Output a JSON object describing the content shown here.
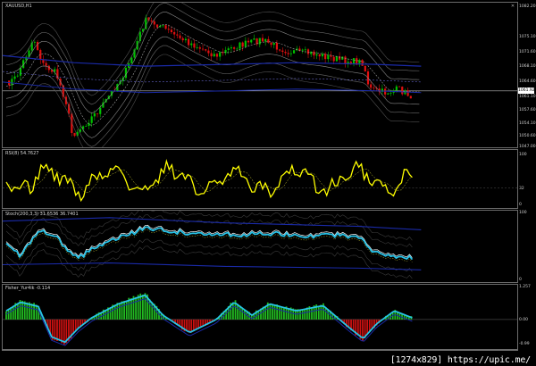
{
  "window": {
    "main_label": "XAUUSD,H1",
    "rsi_label": "RSI(8) 54.7627",
    "stoch_label": "Stoch(200,3,3) 31.6536 36.7401",
    "fisher_label": "Fisher_Yur4ik -0.114"
  },
  "main_axis": [
    "1082.20",
    "1075.10",
    "1071.60",
    "1068.10",
    "1064.60",
    "1061.10",
    "1057.60",
    "1054.10",
    "1050.60",
    "1047.00"
  ],
  "current_price": "1061.92",
  "rsi_axis": [
    "100",
    "32",
    "0"
  ],
  "stoch_axis": [
    "100",
    "0"
  ],
  "fisher_axis": [
    "1.257",
    "0.00",
    "-0.99"
  ],
  "watermark": "[1274x829] https://upic.me/",
  "colors": {
    "bull": "#00c000",
    "bear": "#e01010",
    "bands": "#8a8a8a",
    "ma_blue": "#1a2aa8",
    "rsi": "#ffff00",
    "stoch_main": "#27c4e8",
    "fisher_pos": "#22bb22",
    "fisher_neg": "#cc1111"
  },
  "icons": [
    "close-icon"
  ]
}
